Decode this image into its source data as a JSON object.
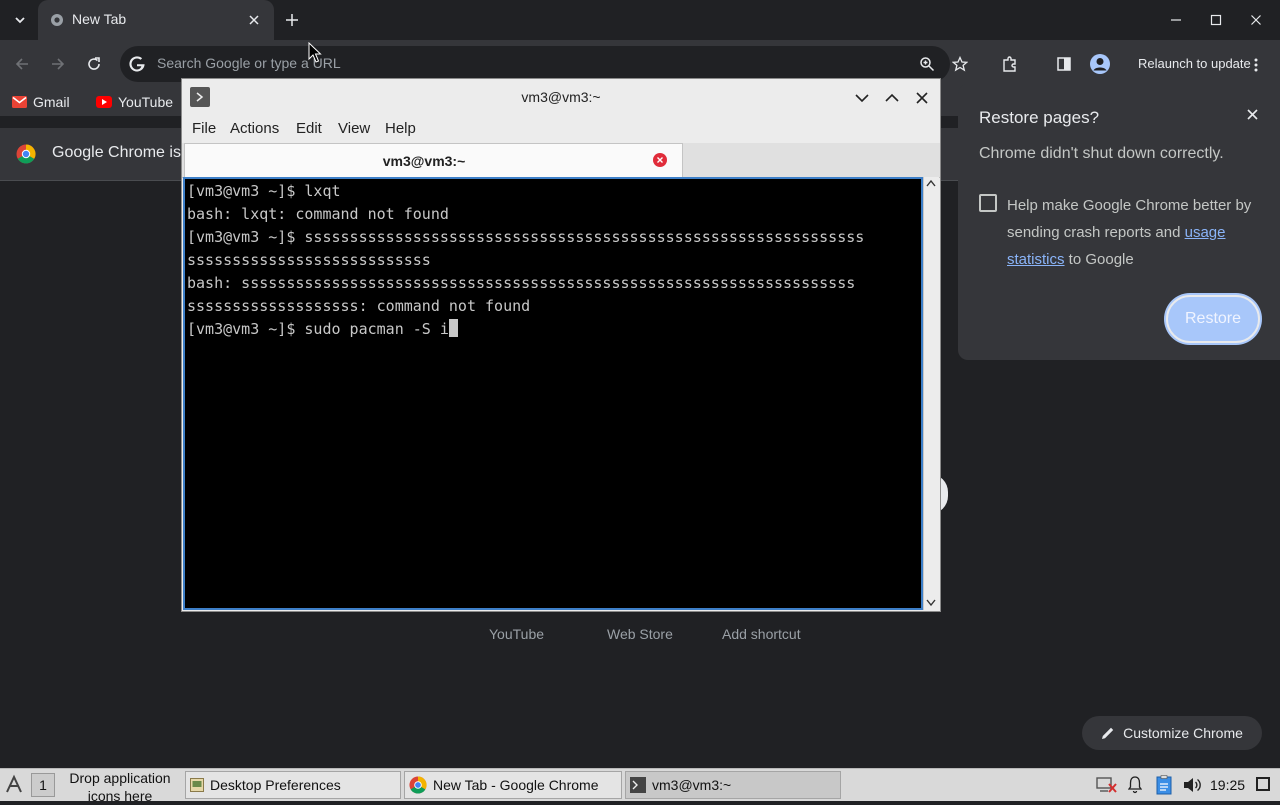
{
  "chrome": {
    "tab_title": "New Tab",
    "omnibox_placeholder": "Search Google or type a URL",
    "relaunch_label": "Relaunch to update",
    "bookmarks": [
      "Gmail",
      "YouTube"
    ],
    "infobar_text": "Google Chrome is",
    "shortcuts": [
      "YouTube",
      "Web Store",
      "Add shortcut"
    ],
    "customize_label": "Customize Chrome"
  },
  "restore": {
    "title": "Restore pages?",
    "message": "Chrome didn't shut down correctly.",
    "checkbox_text_before": "Help make Google Chrome better by sending crash reports and ",
    "checkbox_link": "usage statistics",
    "checkbox_text_after": " to Google",
    "button_label": "Restore"
  },
  "terminal": {
    "title": "vm3@vm3:~",
    "menu": [
      "File",
      "Actions",
      "Edit",
      "View",
      "Help"
    ],
    "tab_title": "vm3@vm3:~",
    "lines": [
      "[vm3@vm3 ~]$ lxqt",
      "bash: lxqt: command not found",
      "[vm3@vm3 ~]$ ssssssssssssssssssssssssssssssssssssssssssssssssssssssssssssss",
      "sssssssssssssssssssssssssss",
      "bash: ssssssssssssssssssssssssssssssssssssssssssssssssssssssssssssssssssss",
      "sssssssssssssssssss: command not found"
    ],
    "current_prompt": "[vm3@vm3 ~]$ sudo pacman -S i"
  },
  "taskbar": {
    "desktop_number": "1",
    "drop_hint_line1": "Drop application",
    "drop_hint_line2": "icons here",
    "items": [
      "Desktop Preferences",
      "New Tab - Google Chrome",
      "vm3@vm3:~"
    ],
    "clock": "19:25"
  },
  "colors": {
    "chrome_dark": "#202124",
    "chrome_surface": "#35363a",
    "link_blue": "#8ab4f8",
    "restore_button": "#a8c7fa",
    "terminal_focus_border": "#3d7fc8"
  }
}
